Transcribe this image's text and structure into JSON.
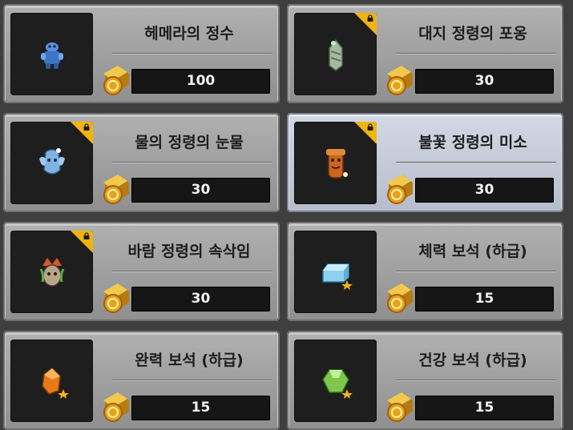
{
  "items": [
    {
      "name": "헤메라의 정수",
      "cost": "100",
      "locked": false,
      "selected": false,
      "icon": "blue-golem-icon",
      "color": "#4a7fd0"
    },
    {
      "name": "대지 정령의 포옹",
      "cost": "30",
      "locked": true,
      "selected": false,
      "icon": "earth-spirit-icon",
      "color": "#9fb79a"
    },
    {
      "name": "물의 정령의 눈물",
      "cost": "30",
      "locked": true,
      "selected": false,
      "icon": "water-spirit-icon",
      "color": "#7fb2de"
    },
    {
      "name": "불꽃 정령의 미소",
      "cost": "30",
      "locked": true,
      "selected": true,
      "icon": "fire-spirit-icon",
      "color": "#c9651f"
    },
    {
      "name": "바람 정령의 속삭임",
      "cost": "30",
      "locked": true,
      "selected": false,
      "icon": "wind-spirit-icon",
      "color": "#b1443a"
    },
    {
      "name": "체력 보석 (하급)",
      "cost": "15",
      "locked": false,
      "selected": false,
      "icon": "blue-gem-icon",
      "color": "#8fd0ee"
    },
    {
      "name": "완력 보석 (하급)",
      "cost": "15",
      "locked": false,
      "selected": false,
      "icon": "orange-gem-icon",
      "color": "#e77a17"
    },
    {
      "name": "건강 보석 (하급)",
      "cost": "15",
      "locked": false,
      "selected": false,
      "icon": "green-gem-icon",
      "color": "#7ec64d"
    }
  ]
}
